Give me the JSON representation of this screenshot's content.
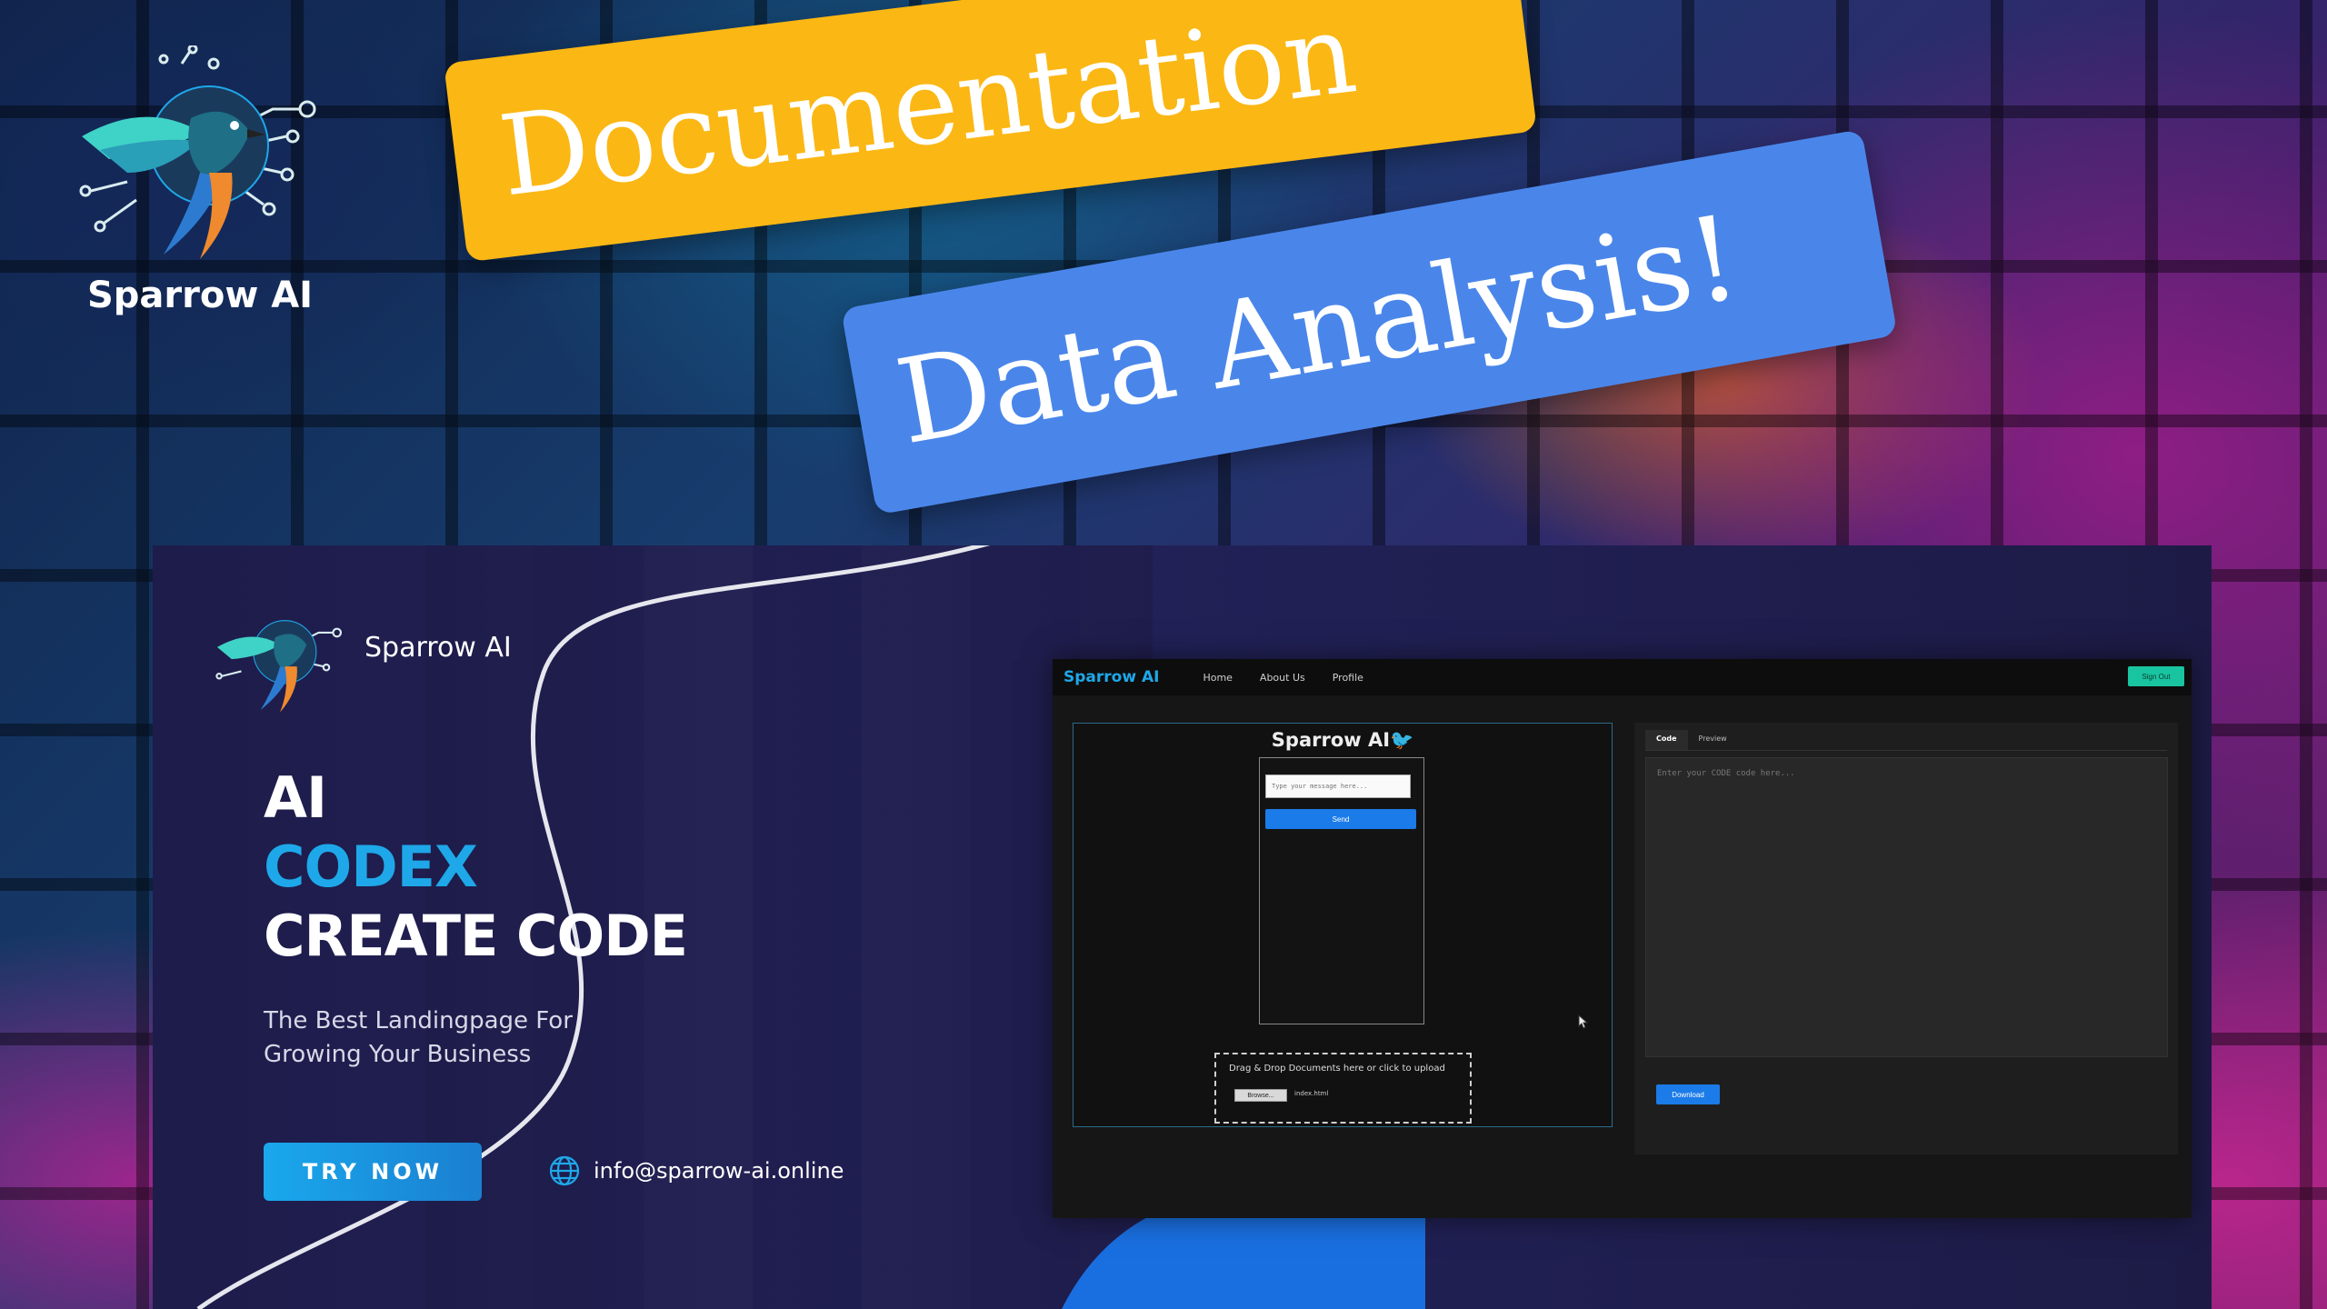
{
  "brand": {
    "name": "Sparrow AI"
  },
  "labels": {
    "documentation": "Documentation",
    "data_analysis": "Data Analysis!"
  },
  "landing": {
    "brand_name": "Sparrow AI",
    "hero": {
      "line1": "AI",
      "line2": "CODEX",
      "line3": "CREATE CODE"
    },
    "tagline_line1": "The Best Landingpage For",
    "tagline_line2": "Growing Your Business",
    "cta_label": "TRY NOW",
    "email": "info@sparrow-ai.online"
  },
  "app": {
    "logo": "Sparrow AI",
    "nav": [
      "Home",
      "About Us",
      "Profile"
    ],
    "signout_label": "Sign Out",
    "chat_title": "Sparrow AI",
    "chat_title_icon": "🐦",
    "chat_placeholder": "Type your message here...",
    "send_label": "Send",
    "drop_text": "Drag & Drop Documents here or click to upload",
    "browse_label": "Browse...",
    "file_name": "index.html",
    "code_tabs": [
      "Code",
      "Preview"
    ],
    "code_placeholder": "Enter your CODE code here...",
    "download_label": "Download"
  },
  "colors": {
    "doc_label": "#fbb714",
    "data_label": "#4a86ea",
    "accent_cyan": "#1ea8e9",
    "panel_bg": "#1e1c4a"
  }
}
